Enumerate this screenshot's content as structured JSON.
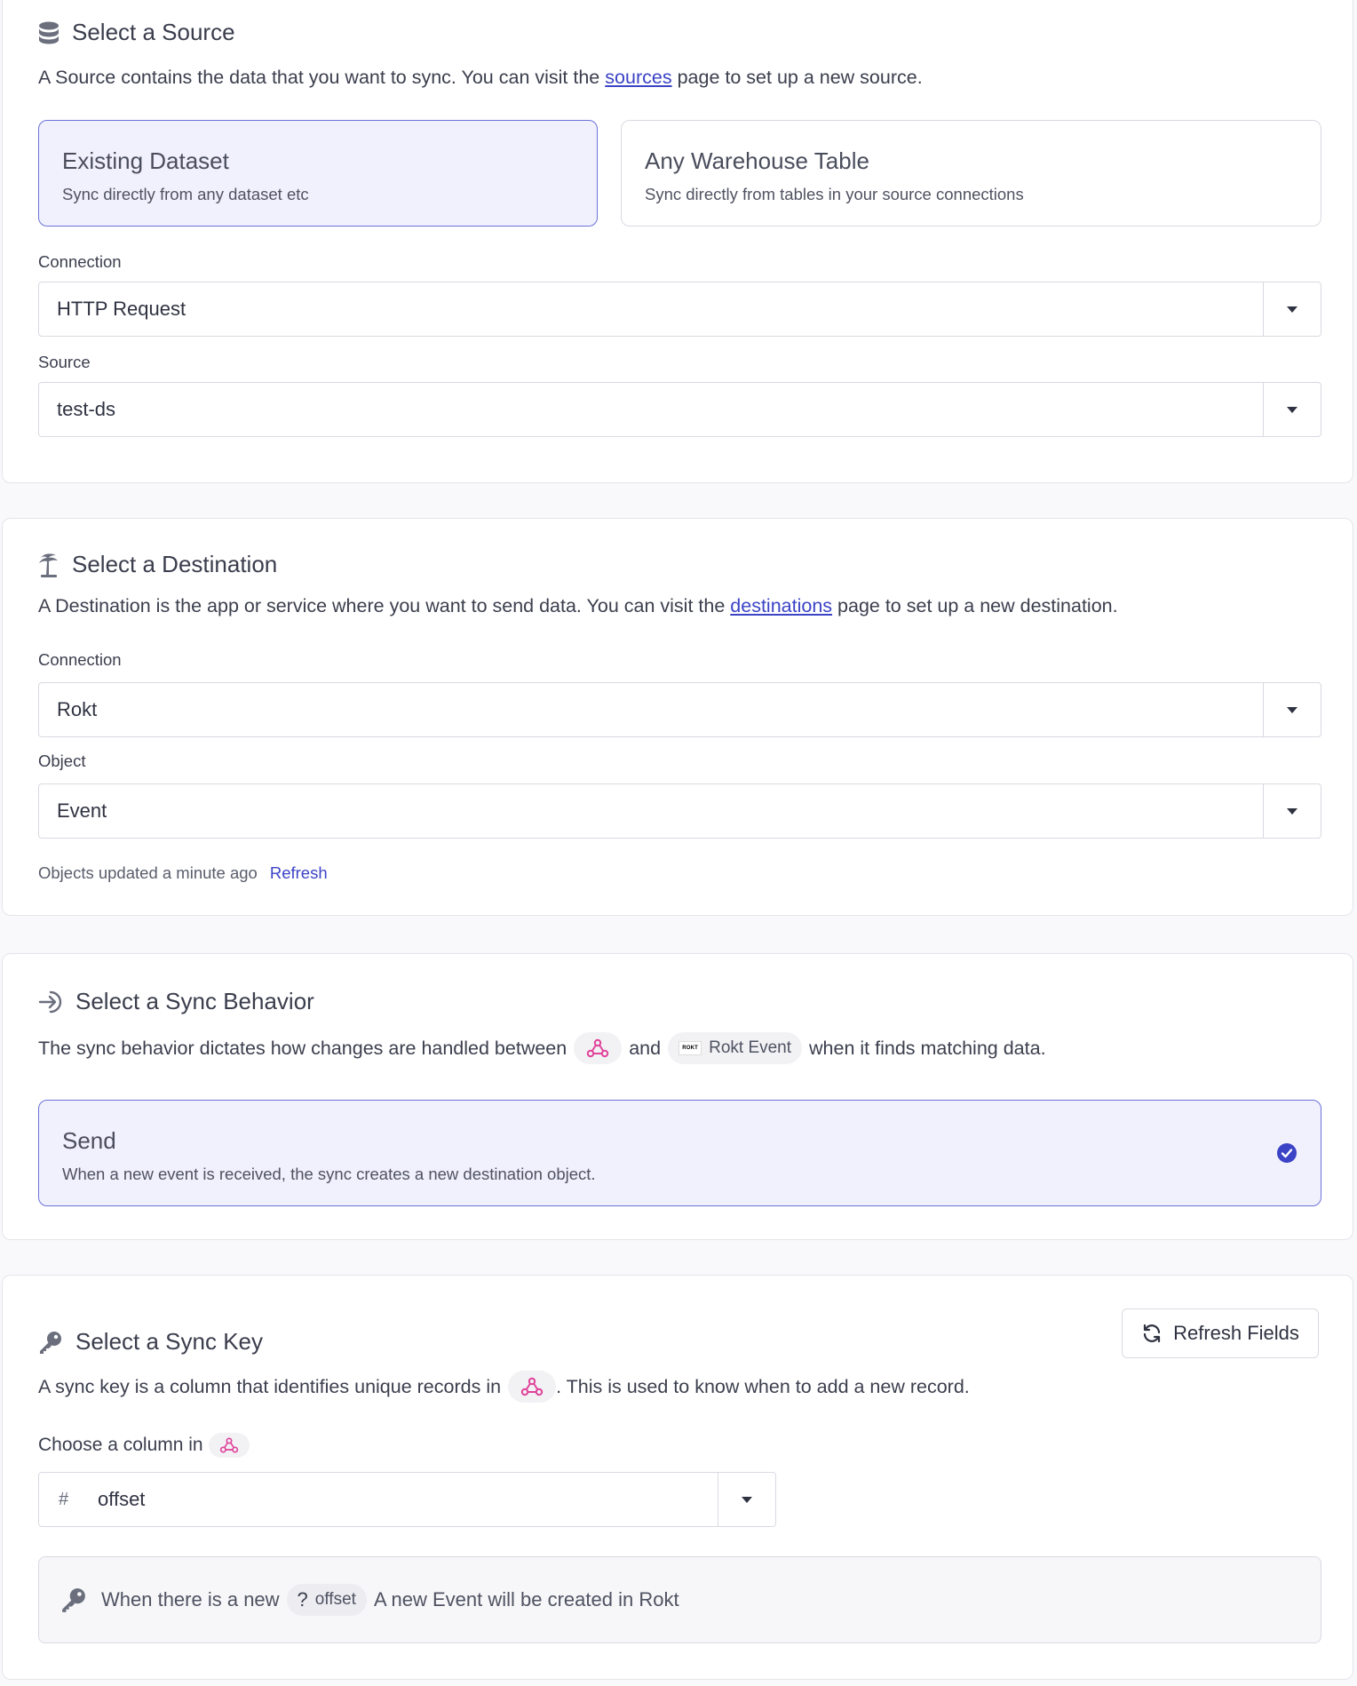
{
  "source": {
    "title": "Select a Source",
    "desc_before": "A Source contains the data that you want to sync. You can visit the",
    "desc_link": "sources",
    "desc_after": "page to set up a new source.",
    "options": [
      {
        "title": "Existing Dataset",
        "subtitle": "Sync directly from any dataset etc",
        "selected": true
      },
      {
        "title": "Any Warehouse Table",
        "subtitle": "Sync directly from tables in your source connections",
        "selected": false
      }
    ],
    "connection_label": "Connection",
    "connection_value": "HTTP Request",
    "source_label": "Source",
    "source_value": "test-ds"
  },
  "destination": {
    "title": "Select a Destination",
    "desc_before": "A Destination is the app or service where you want to send data. You can visit the",
    "desc_link": "destinations",
    "desc_after": "page to set up a new destination.",
    "connection_label": "Connection",
    "connection_value": "Rokt",
    "object_label": "Object",
    "object_value": "Event",
    "updated_text": "Objects updated a minute ago",
    "refresh_link": "Refresh"
  },
  "behavior": {
    "title": "Select a Sync Behavior",
    "desc_before": "The sync behavior dictates how changes are handled between",
    "desc_and": "and",
    "rokt_logo_text": "ROKT",
    "dest_chip_label": "Rokt Event",
    "desc_after": "when it finds matching data.",
    "option_title": "Send",
    "option_subtitle": "When a new event is received, the sync creates a new destination object."
  },
  "sync_key": {
    "title": "Select a Sync Key",
    "refresh_button": "Refresh Fields",
    "desc_before": "A sync key is a column that identifies unique records in",
    "desc_after": ". This is used to know when to add a new record.",
    "choose_label": "Choose a column in",
    "column_type_symbol": "#",
    "column_value": "offset",
    "info_before": "When there is a new",
    "info_chip_symbol": "?",
    "info_chip_label": "offset",
    "info_after": "A new Event will be created in Rokt"
  },
  "colors": {
    "accent": "#3b43c6",
    "selected_bg": "#f1f1fd",
    "webhook_pink": "#e0439a"
  },
  "icons": [
    "database-icon",
    "palm-tree-icon",
    "sign-in-arrow-icon",
    "key-icon",
    "webhook-icon",
    "refresh-icon",
    "check-circle-icon",
    "chevron-down-icon"
  ]
}
